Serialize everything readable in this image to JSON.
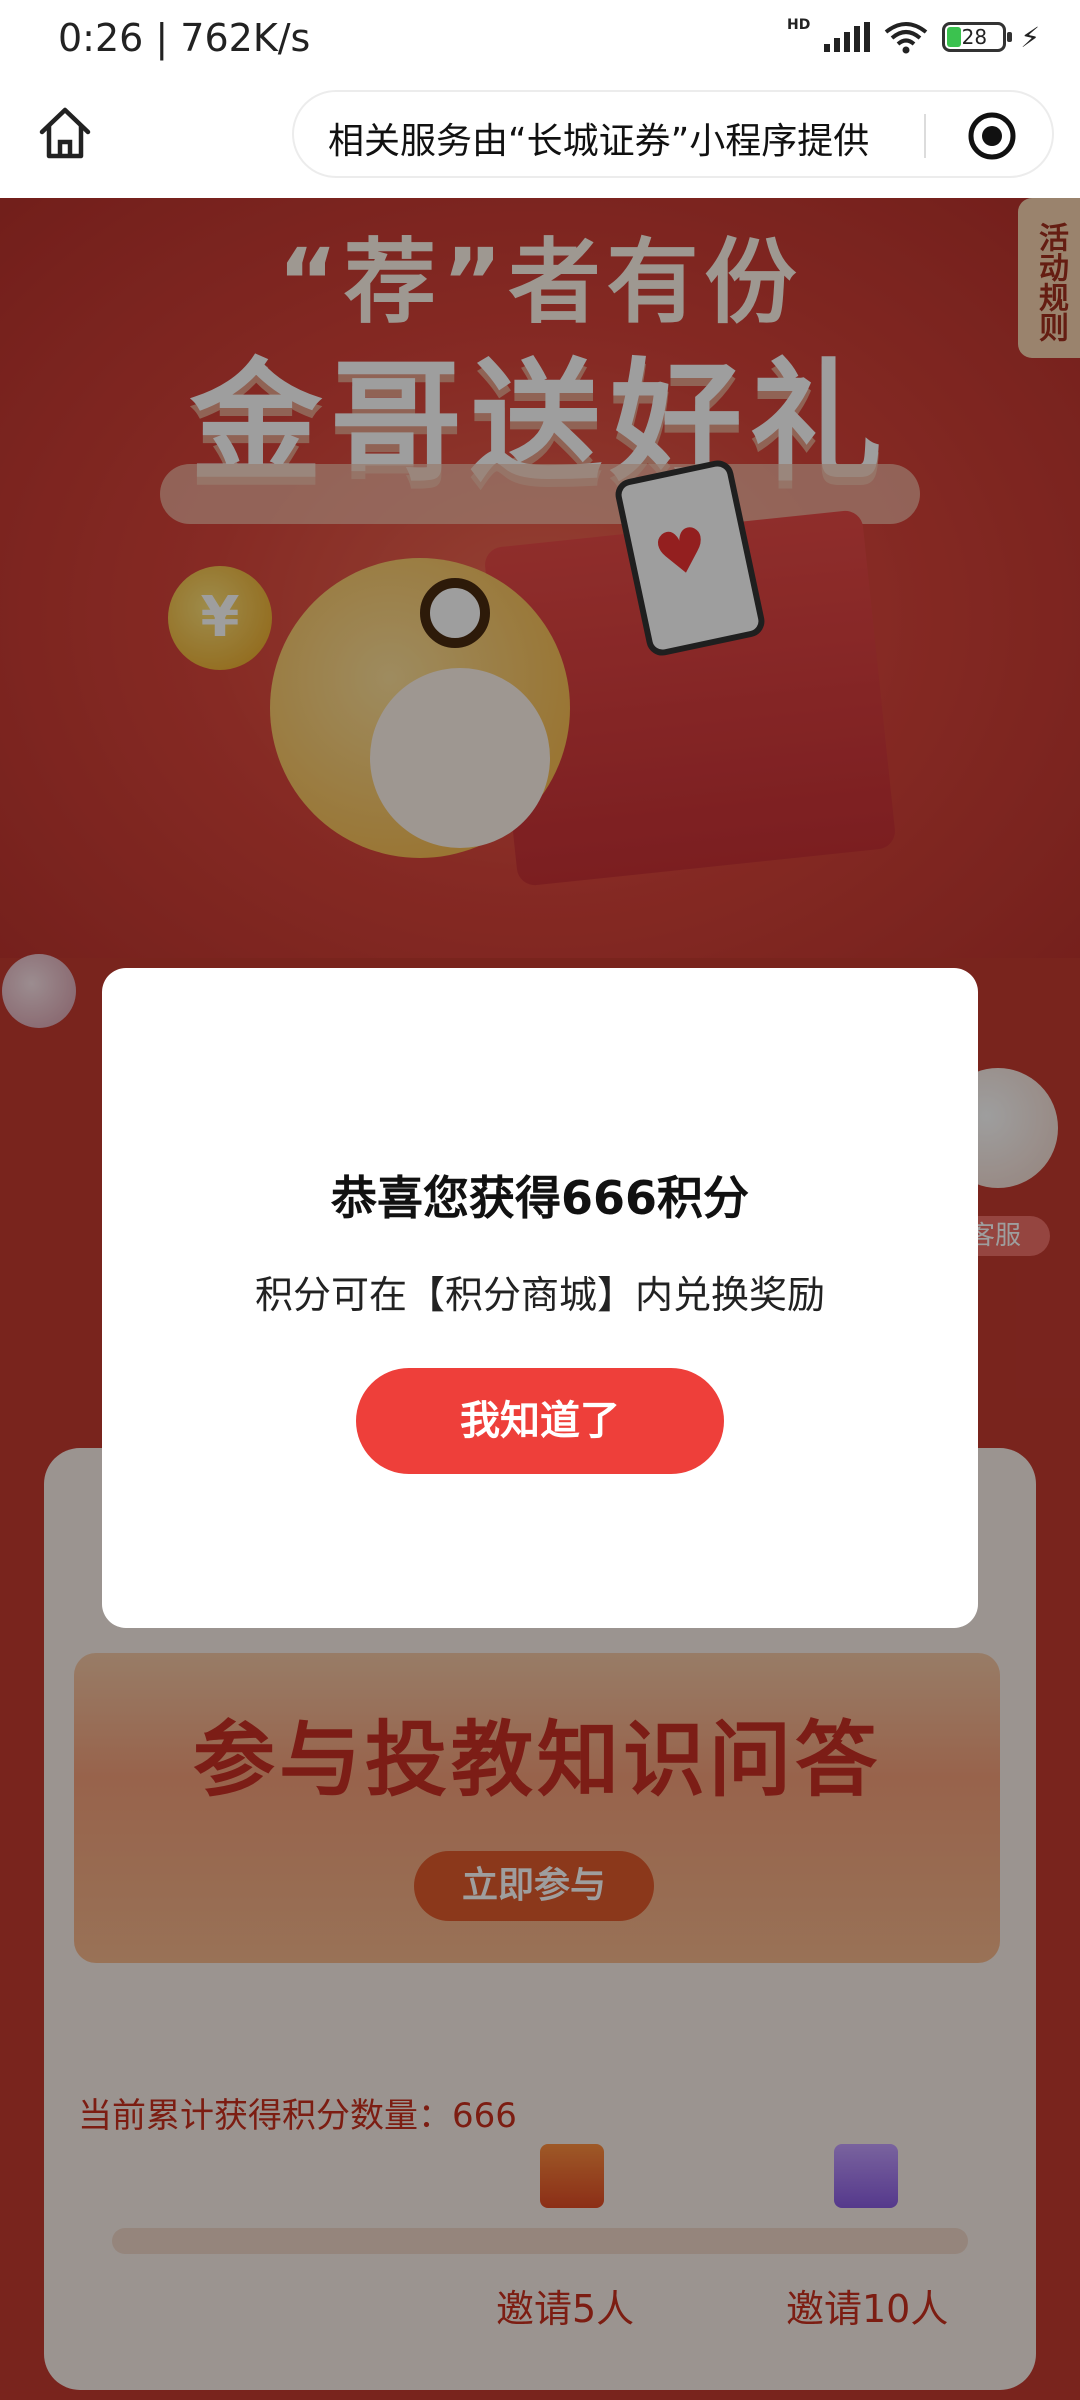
{
  "status_bar": {
    "time": "0:26 | 762K/s",
    "network_badge": "HD",
    "battery_level": "28",
    "icons": [
      "signal-icon",
      "wifi-icon",
      "battery-icon",
      "charging-icon"
    ]
  },
  "nav": {
    "home_icon": "home-icon",
    "mini_program_text": "相关服务由“长城证券”小程序提供",
    "more_icon": "target-icon"
  },
  "hero": {
    "title_line1": "“荐”者有份",
    "title_line2": "金哥送好礼",
    "coin_symbol": "¥"
  },
  "side_tab": {
    "rules_label": "活动规则"
  },
  "customer_service": {
    "label": "客服"
  },
  "quiz_banner": {
    "title": "参与投教知识问答",
    "button_label": "立即参与"
  },
  "progress_card": {
    "points_label": "当前累计获得积分数量：666",
    "progress_fraction": 0.0,
    "milestones": [
      {
        "label": "邀请5人",
        "gift_icon": "gift-box-orange-icon"
      },
      {
        "label": "邀请10人",
        "gift_icon": "gift-box-purple-icon"
      }
    ]
  },
  "modal": {
    "title": "恭喜您获得666积分",
    "subtitle": "积分可在【积分商城】内兑换奖励",
    "confirm_label": "我知道了"
  },
  "colors": {
    "accent_red": "#ee3f3a",
    "page_red": "#c43a30",
    "card_bg": "#fbefe8",
    "text_red": "#c8301e"
  }
}
